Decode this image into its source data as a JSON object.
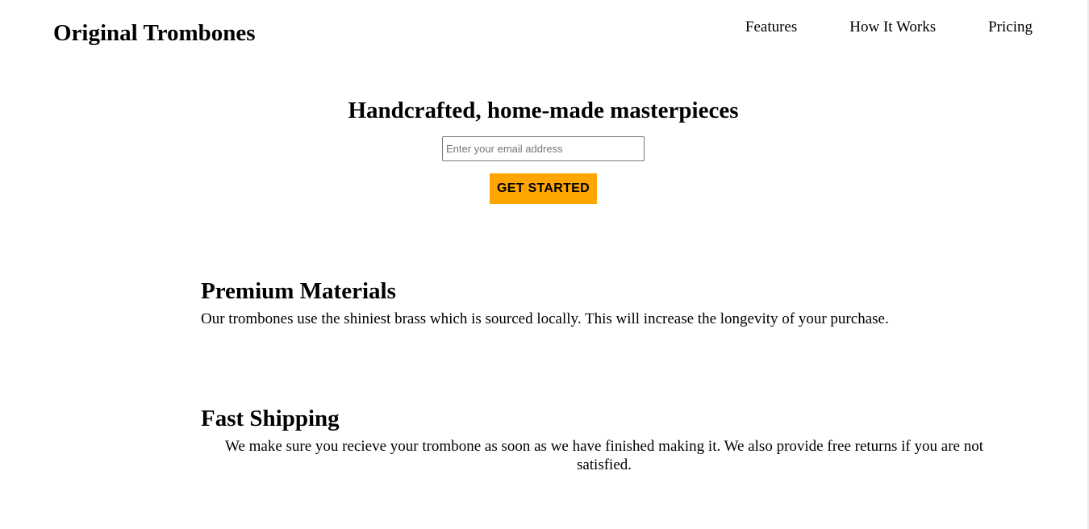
{
  "header": {
    "logo": "Original Trombones",
    "nav": [
      {
        "label": "Features"
      },
      {
        "label": "How It Works"
      },
      {
        "label": "Pricing"
      }
    ]
  },
  "hero": {
    "title": "Handcrafted, home-made masterpieces",
    "email_placeholder": "Enter your email address",
    "email_value": "",
    "cta_label": "GET STARTED",
    "cta_color": "#ffa500"
  },
  "features": [
    {
      "title": "Premium Materials",
      "text": "Our trombones use the shiniest brass which is sourced locally. This will increase the longevity of your purchase."
    },
    {
      "title": "Fast Shipping",
      "text": "We make sure you recieve your trombone as soon as we have finished making it. We also provide free returns if you are not satisfied."
    }
  ]
}
